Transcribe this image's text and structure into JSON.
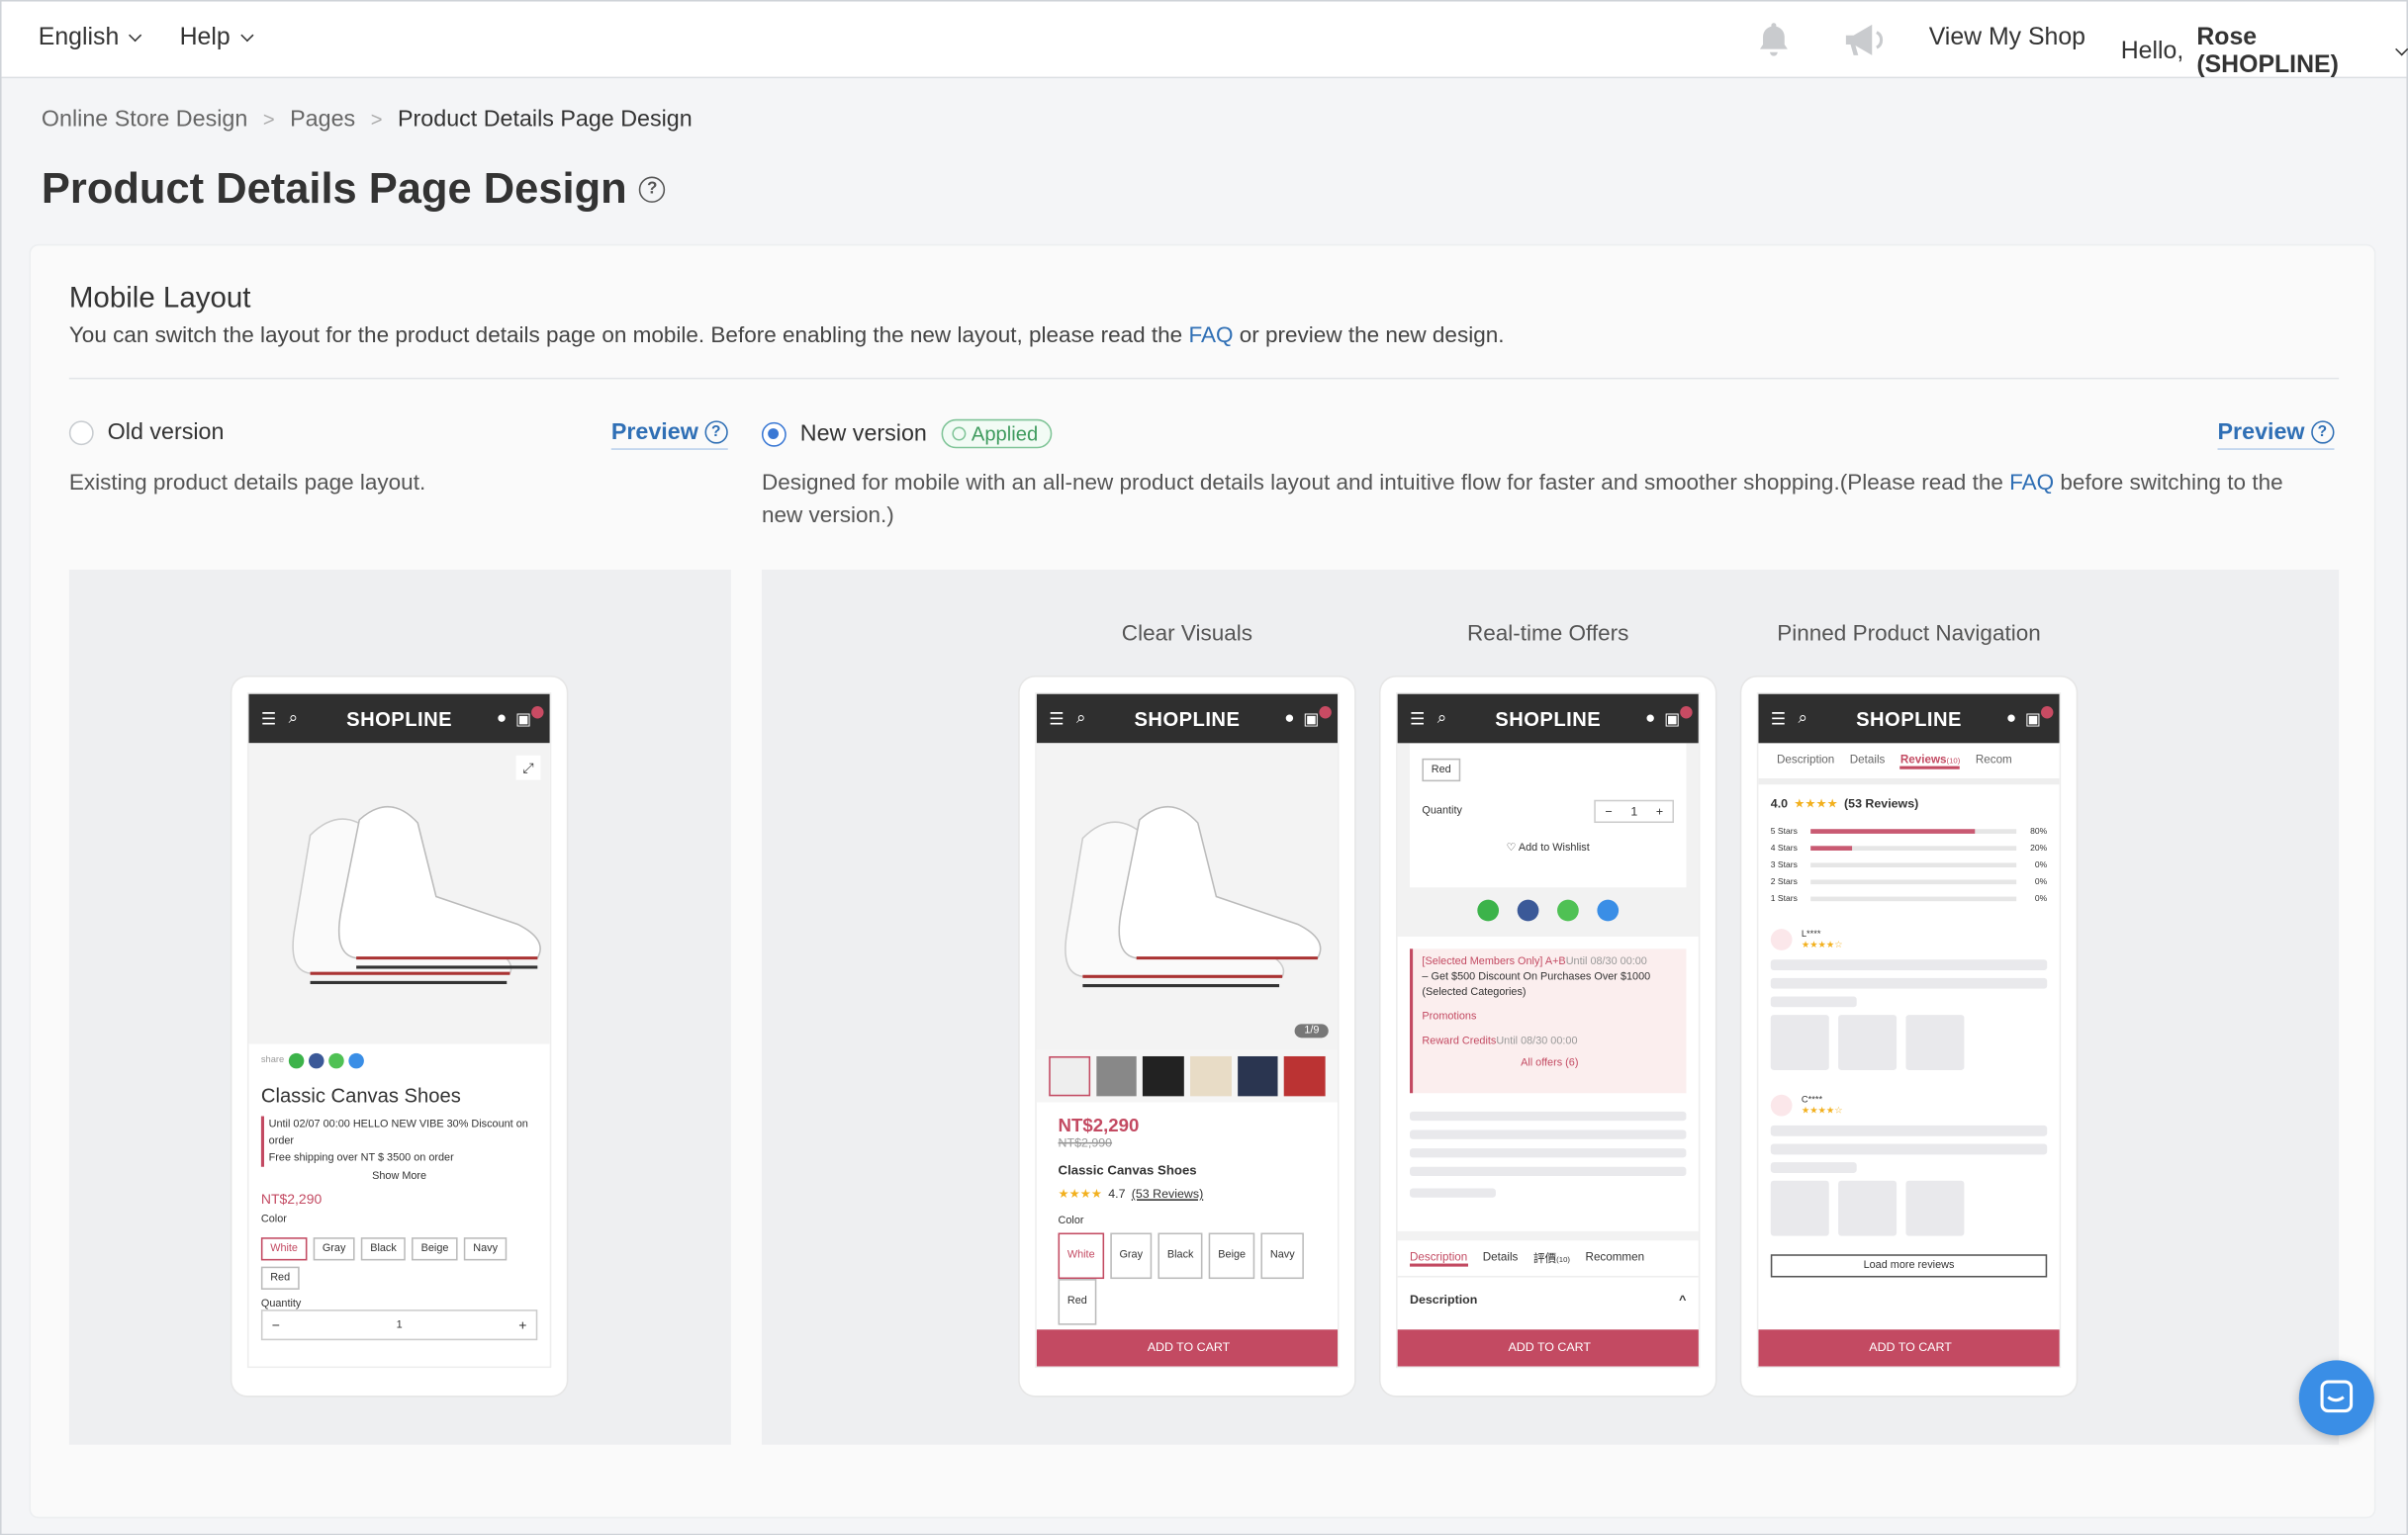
{
  "topbar": {
    "language": "English",
    "help": "Help",
    "view_shop": "View My Shop",
    "greeting_prefix": "Hello, ",
    "user": "Rose (SHOPLINE)"
  },
  "breadcrumb": [
    "Online Store Design",
    "Pages",
    "Product Details Page Design"
  ],
  "page_title": "Product Details Page Design",
  "section": {
    "title": "Mobile Layout",
    "desc_before": "You can switch the layout for the product details page on mobile. Before enabling the new layout, please read the ",
    "desc_link": "FAQ",
    "desc_after": " or preview the new design."
  },
  "old_option": {
    "label": "Old version",
    "preview": "Preview",
    "desc": "Existing product details page layout."
  },
  "new_option": {
    "label": "New version",
    "badge": "Applied",
    "preview": "Preview",
    "desc_before": "Designed for mobile with an all-new product details layout and intuitive flow for faster and smoother shopping.(Please read the ",
    "desc_link": "FAQ",
    "desc_after": " before switching to the new version.)"
  },
  "captions": [
    "Clear Visuals",
    "Real-time Offers",
    "Pinned Product Navigation"
  ],
  "mockup": {
    "logo": "SHOPLINE",
    "share": "share",
    "product_name": "Classic Canvas Shoes",
    "promo1": "Until 02/07 00:00 HELLO NEW VIBE 30% Discount on order",
    "promo2": "Free shipping over NT $ 3500 on order",
    "show_more": "Show More",
    "price": "NT$2,290",
    "old_price": "NT$2,990",
    "color_label": "Color",
    "colors": [
      "White",
      "Gray",
      "Black",
      "Beige",
      "Navy",
      "Red"
    ],
    "quantity_label": "Quantity",
    "qty": "1",
    "rating": "4.7",
    "reviews_link": "(53 Reviews)",
    "image_counter": "1/9",
    "add_to_cart": "ADD TO CART",
    "add_wishlist": "Add to Wishlist",
    "offer_text": "[Selected Members Only] A+B",
    "offer_until": "Until 08/30 00:00",
    "offer_detail": "– Get $500 Discount On Purchases Over $1000 (Selected Categories)",
    "promotions": "Promotions",
    "reward_credits": "Reward Credits",
    "reward_until": "Until 08/30 00:00",
    "all_offers": "All offers (6)",
    "tabs": [
      "Description",
      "Details",
      "評價",
      "Recommen"
    ],
    "tab_count": "(10)",
    "description_head": "Description",
    "review_tabs": [
      "Description",
      "Details",
      "Reviews",
      "Recom"
    ],
    "review_score": "4.0",
    "review_total": "(53 Reviews)",
    "star_rows": [
      {
        "label": "5 Stars",
        "pct": "80%",
        "fill": 0.8
      },
      {
        "label": "4 Stars",
        "pct": "20%",
        "fill": 0.2
      },
      {
        "label": "3 Stars",
        "pct": "0%",
        "fill": 0
      },
      {
        "label": "2 Stars",
        "pct": "0%",
        "fill": 0
      },
      {
        "label": "1 Stars",
        "pct": "0%",
        "fill": 0
      }
    ],
    "reviewer1": "L****",
    "reviewer2": "C****",
    "load_more": "Load more reviews"
  },
  "colors": {
    "brand": "#c34a62",
    "link": "#2f6fb5",
    "applied": "#3f9b5e"
  }
}
